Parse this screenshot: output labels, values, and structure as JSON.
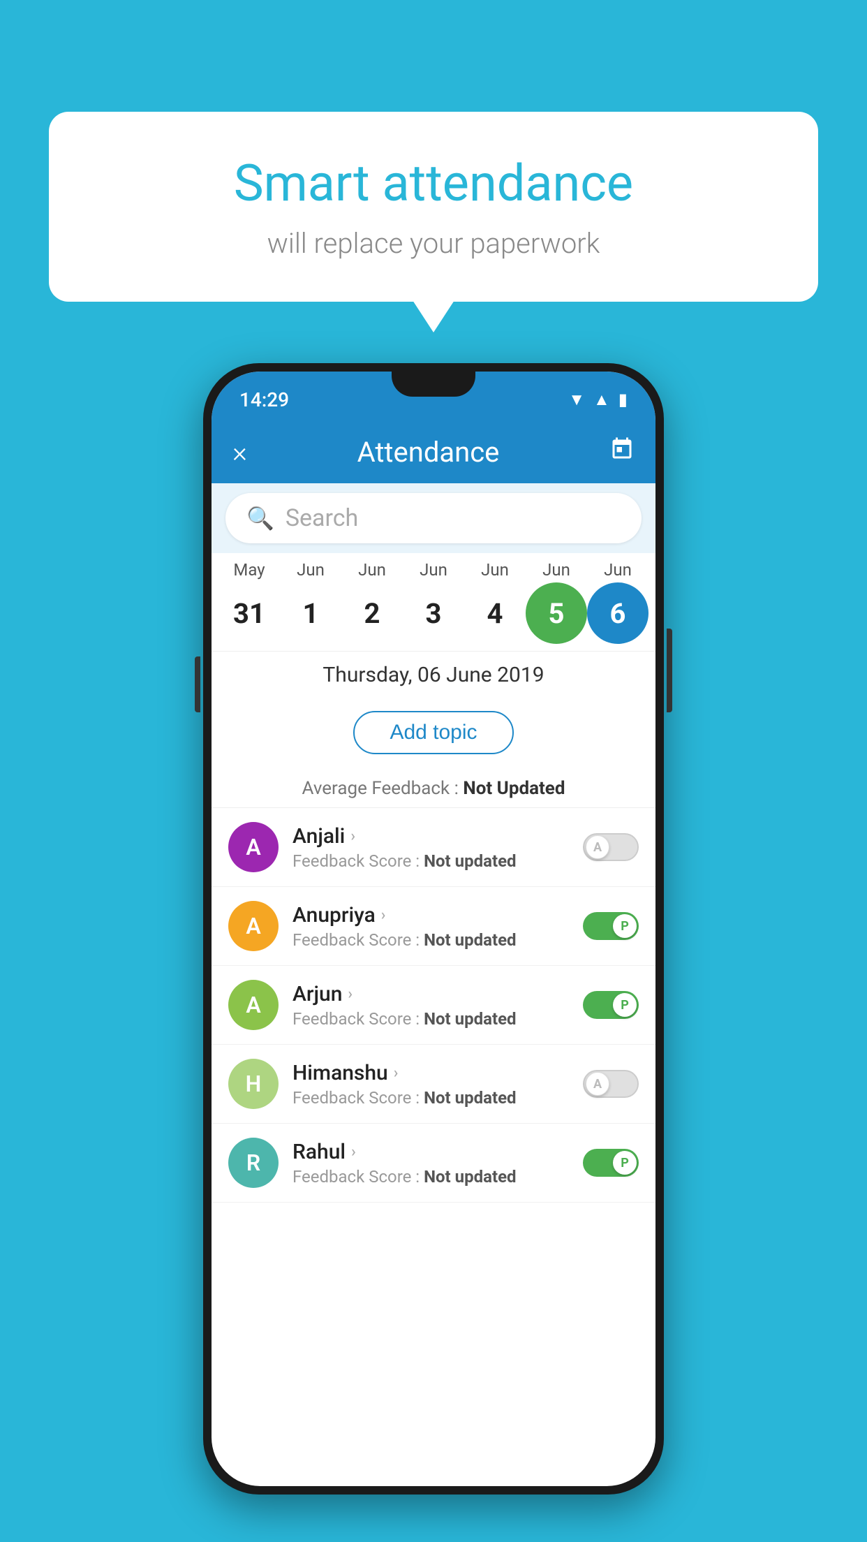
{
  "background_color": "#29b6d8",
  "speech_bubble": {
    "title": "Smart attendance",
    "subtitle": "will replace your paperwork"
  },
  "status_bar": {
    "time": "14:29",
    "icons": [
      "wifi",
      "signal",
      "battery"
    ]
  },
  "app_header": {
    "close_label": "×",
    "title": "Attendance",
    "calendar_icon": "📅"
  },
  "search": {
    "placeholder": "Search"
  },
  "calendar": {
    "months": [
      "May",
      "Jun",
      "Jun",
      "Jun",
      "Jun",
      "Jun",
      "Jun"
    ],
    "days": [
      "31",
      "1",
      "2",
      "3",
      "4",
      "5",
      "6"
    ],
    "today_index": 5,
    "selected_index": 6
  },
  "date_selected": "Thursday, 06 June 2019",
  "add_topic_label": "Add topic",
  "avg_feedback": {
    "label": "Average Feedback : ",
    "value": "Not Updated"
  },
  "students": [
    {
      "name": "Anjali",
      "avatar_letter": "A",
      "avatar_color": "#9c27b0",
      "feedback": "Feedback Score : ",
      "feedback_value": "Not updated",
      "toggle": "off",
      "toggle_letter": "A"
    },
    {
      "name": "Anupriya",
      "avatar_letter": "A",
      "avatar_color": "#f5a623",
      "feedback": "Feedback Score : ",
      "feedback_value": "Not updated",
      "toggle": "on",
      "toggle_letter": "P"
    },
    {
      "name": "Arjun",
      "avatar_letter": "A",
      "avatar_color": "#8bc34a",
      "feedback": "Feedback Score : ",
      "feedback_value": "Not updated",
      "toggle": "on",
      "toggle_letter": "P"
    },
    {
      "name": "Himanshu",
      "avatar_letter": "H",
      "avatar_color": "#aed581",
      "feedback": "Feedback Score : ",
      "feedback_value": "Not updated",
      "toggle": "off",
      "toggle_letter": "A"
    },
    {
      "name": "Rahul",
      "avatar_letter": "R",
      "avatar_color": "#4db6ac",
      "feedback": "Feedback Score : ",
      "feedback_value": "Not updated",
      "toggle": "on",
      "toggle_letter": "P"
    }
  ]
}
